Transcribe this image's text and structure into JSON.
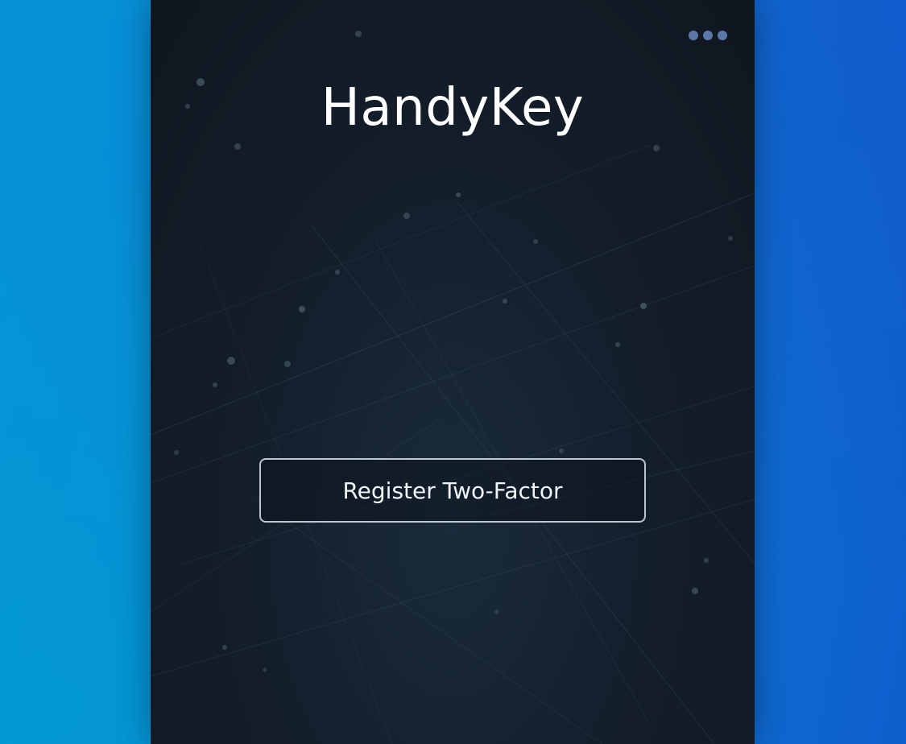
{
  "app": {
    "title": "HandyKey"
  },
  "menu": {
    "icon": "more-dots-icon",
    "dot_color": "#5b78a6"
  },
  "actions": {
    "register_label": "Register Two-Factor"
  },
  "colors": {
    "window_background": "#141f2c",
    "desktop_gradient_start": "#0593d6",
    "desktop_gradient_end": "#0e5fcd",
    "title_text": "#ffffff",
    "button_border": "#dce4ec"
  }
}
